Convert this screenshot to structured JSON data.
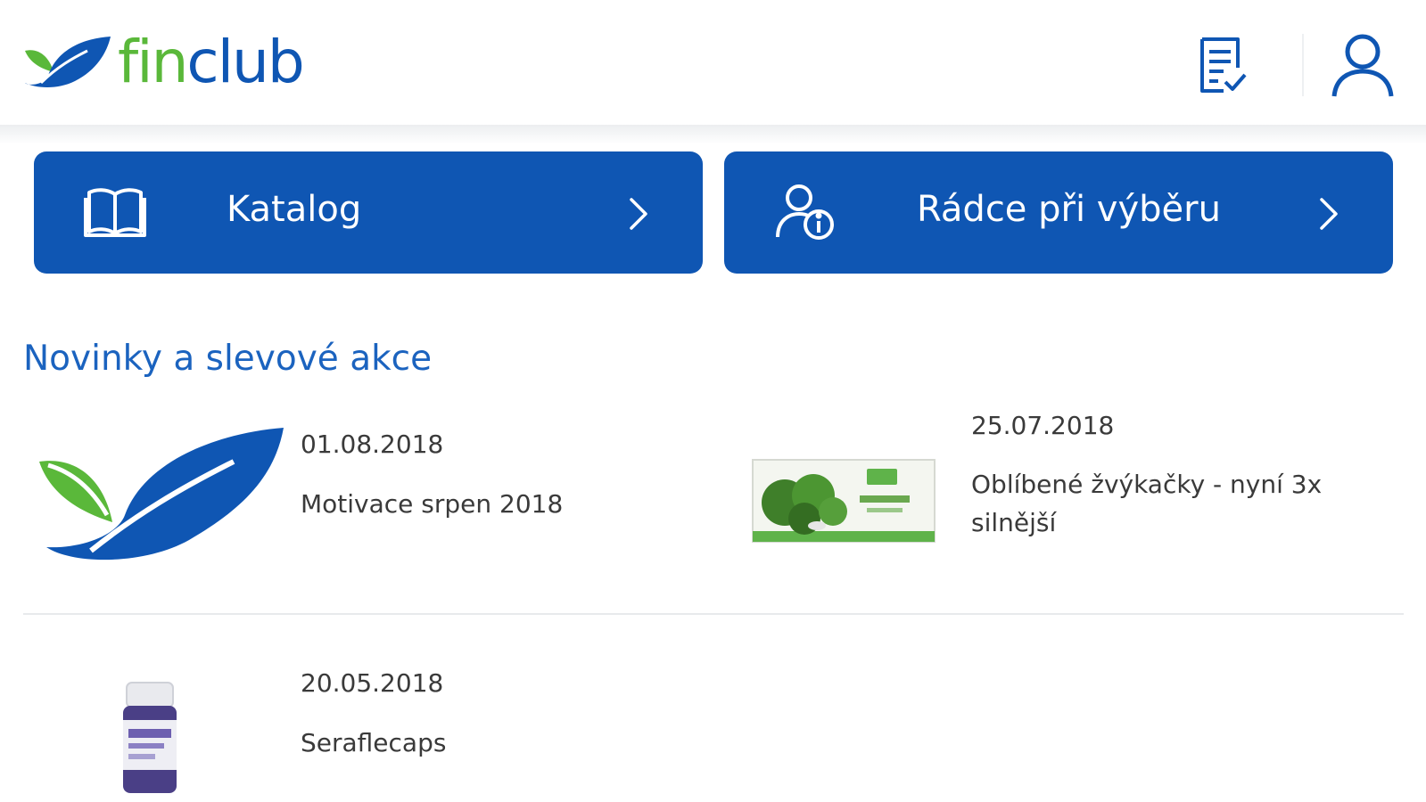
{
  "header": {
    "logo": {
      "part1": "fin",
      "part2": "club"
    },
    "icons": {
      "orders": "checklist-icon",
      "account": "user-icon"
    }
  },
  "nav": {
    "katalog": {
      "label": "Katalog",
      "icon": "book-icon"
    },
    "radce": {
      "label": "Rádce při výběru",
      "icon": "person-info-icon"
    }
  },
  "section": {
    "title": "Novinky a slevové akce"
  },
  "news": [
    {
      "date": "01.08.2018",
      "title": "Motivace srpen 2018",
      "image": "finclub-leaf-logo"
    },
    {
      "date": "25.07.2018",
      "title": "Oblíbené žvýkačky - nyní 3x silnější",
      "image": "gum-package"
    },
    {
      "date": "20.05.2018",
      "title": "Seraflecaps",
      "image": "supplement-bottle"
    }
  ],
  "colors": {
    "brand_blue": "#0f56b3",
    "brand_green": "#5ab83a",
    "text": "#3a3a3a"
  }
}
